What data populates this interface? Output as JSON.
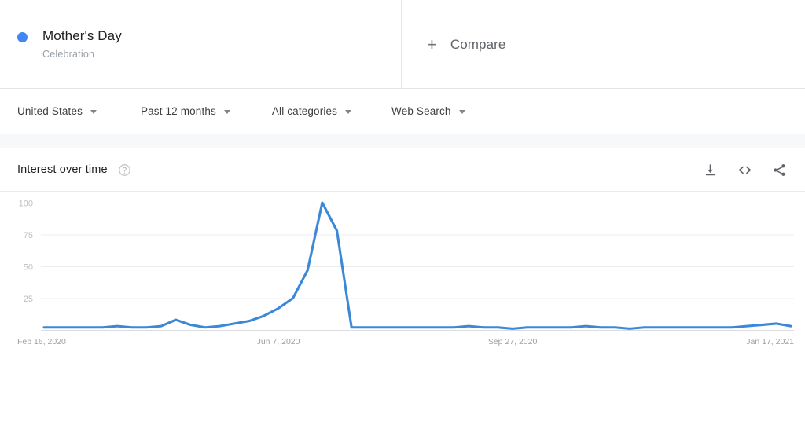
{
  "terms": [
    {
      "name": "Mother's Day",
      "type": "Celebration",
      "color": "#4285f4"
    }
  ],
  "compare": {
    "label": "Compare",
    "plus_icon": "plus-icon"
  },
  "filters": [
    {
      "label": "United States",
      "name": "location"
    },
    {
      "label": "Past 12 months",
      "name": "time-range"
    },
    {
      "label": "All categories",
      "name": "category"
    },
    {
      "label": "Web Search",
      "name": "search-type"
    }
  ],
  "card": {
    "title": "Interest over time",
    "help_icon": "help-circle-icon",
    "actions": [
      {
        "name": "download-csv-icon",
        "icon": "download-icon"
      },
      {
        "name": "embed-icon",
        "icon": "code-brackets-icon"
      },
      {
        "name": "share-icon",
        "icon": "share-nodes-icon"
      }
    ]
  },
  "chart_data": {
    "type": "line",
    "title": "Interest over time",
    "xlabel": "",
    "ylabel": "",
    "ylim": [
      0,
      100
    ],
    "yticks": [
      25,
      50,
      75,
      100
    ],
    "grid": true,
    "legend_position": "top",
    "line_color": "#3b88d8",
    "xticks": [
      "Feb 16, 2020",
      "Jun 7, 2020",
      "Sep 27, 2020",
      "Jan 17, 2021"
    ],
    "xtick_positions": [
      0,
      16,
      32,
      48
    ],
    "series": [
      {
        "name": "Mother's Day",
        "values": [
          2,
          2,
          2,
          2,
          2,
          3,
          2,
          2,
          3,
          8,
          4,
          2,
          3,
          5,
          7,
          11,
          17,
          25,
          47,
          100,
          78,
          2,
          2,
          2,
          2,
          2,
          2,
          2,
          2,
          3,
          2,
          2,
          1,
          2,
          2,
          2,
          2,
          3,
          2,
          2,
          1,
          2,
          2,
          2,
          2,
          2,
          2,
          2,
          3,
          4,
          5,
          3
        ]
      }
    ]
  }
}
